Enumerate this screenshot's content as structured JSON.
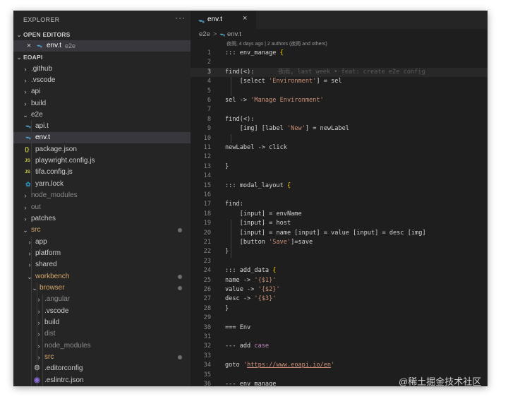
{
  "explorer": {
    "title": "EXPLORER",
    "more": "···",
    "open_editors_label": "OPEN EDITORS",
    "open_editor": {
      "name": "env.t",
      "folder": "e2e"
    },
    "root_label": "EOAPI",
    "items": [
      {
        "label": ".github",
        "chev": ">"
      },
      {
        "label": ".vscode",
        "chev": ">"
      },
      {
        "label": "api",
        "chev": ">"
      },
      {
        "label": "build",
        "chev": ">"
      },
      {
        "label": "e2e",
        "chev": "v"
      },
      {
        "label": "api.t",
        "icon": "t"
      },
      {
        "label": "env.t",
        "icon": "t"
      },
      {
        "label": "package.json",
        "icon": "{}"
      },
      {
        "label": "playwright.config.js",
        "icon": "JS"
      },
      {
        "label": "tifa.config.js",
        "icon": "JS"
      },
      {
        "label": "yarn.lock",
        "icon": "yarn"
      },
      {
        "label": "node_modules",
        "chev": ">"
      },
      {
        "label": "out",
        "chev": ">"
      },
      {
        "label": "patches",
        "chev": ">"
      },
      {
        "label": "src",
        "chev": "v"
      },
      {
        "label": "app",
        "chev": ">"
      },
      {
        "label": "platform",
        "chev": ">"
      },
      {
        "label": "shared",
        "chev": ">"
      },
      {
        "label": "workbench",
        "chev": "v"
      },
      {
        "label": "browser",
        "chev": "v"
      },
      {
        "label": ".angular",
        "chev": ">"
      },
      {
        "label": ".vscode",
        "chev": ">"
      },
      {
        "label": "build",
        "chev": ">"
      },
      {
        "label": "dist",
        "chev": ">"
      },
      {
        "label": "node_modules",
        "chev": ">"
      },
      {
        "label": "src",
        "chev": ">"
      },
      {
        "label": ".editorconfig",
        "icon": "gear"
      },
      {
        "label": ".eslintrc.json",
        "icon": "eslint"
      }
    ]
  },
  "tab": {
    "label": "env.t",
    "close": "×"
  },
  "breadcrumb": {
    "folder": "e2e",
    "sep": ">",
    "file": "env.t"
  },
  "codelens": "夜雨, 4 days ago | 2 authors (夜雨 and others)",
  "blame": "夜雨, last week • feat: create e2e config",
  "code_lines": [
    "1",
    "2",
    "3",
    "4",
    "5",
    "6",
    "7",
    "8",
    "9",
    "10",
    "11",
    "12",
    "13",
    "14",
    "15",
    "16",
    "17",
    "18",
    "19",
    "20",
    "21",
    "22",
    "23",
    "24",
    "25",
    "26",
    "27",
    "28",
    "29",
    "30",
    "31",
    "32",
    "33",
    "34",
    "35",
    "36"
  ],
  "code": {
    "l1a": "::: env_manage ",
    "l1b": "{",
    "l3": "find(<):",
    "l4a": "[select ",
    "l4b": "'Environment'",
    "l4c": "] = sel",
    "l6a": "sel -> ",
    "l6b": "'Manage Environment'",
    "l8": "find(<):",
    "l9a": "[img] [label ",
    "l9b": "'New'",
    "l9c": "] = newLabel",
    "l11": "newLabel -> click",
    "l13": "}",
    "l15a": "::: modal_layout ",
    "l15b": "{",
    "l17": "find:",
    "l18": "[input] = envName",
    "l19": "[input] = host",
    "l20": "[input] = name [input] = value [input] = desc [img]",
    "l21a": "[button ",
    "l21b": "'Save'",
    "l21c": "]=save",
    "l22": "}",
    "l24a": "::: add_data ",
    "l24b": "{",
    "l25a": "name -> ",
    "l25b": "'{$1}'",
    "l26a": "value -> ",
    "l26b": "'{$2}'",
    "l27a": "desc -> ",
    "l27b": "'{$3}'",
    "l28": "}",
    "l30": "=== Env",
    "l32a": "--- add ",
    "l32b": "case",
    "l34a": "goto ",
    "l34b": "'",
    "l34c": "https://www.eoapi.io/en",
    "l34d": "'",
    "l36": "--- env_manage"
  },
  "watermark": "@稀土掘金技术社区",
  "colors": {
    "accent_t_icon": "#519aba",
    "json_icon": "#cbcb41",
    "js_icon": "#cbcb41",
    "yarn_icon": "#2c8ebb",
    "string": "#ce9178",
    "keyword": "#c586c0",
    "bracket": "#ffd700"
  }
}
